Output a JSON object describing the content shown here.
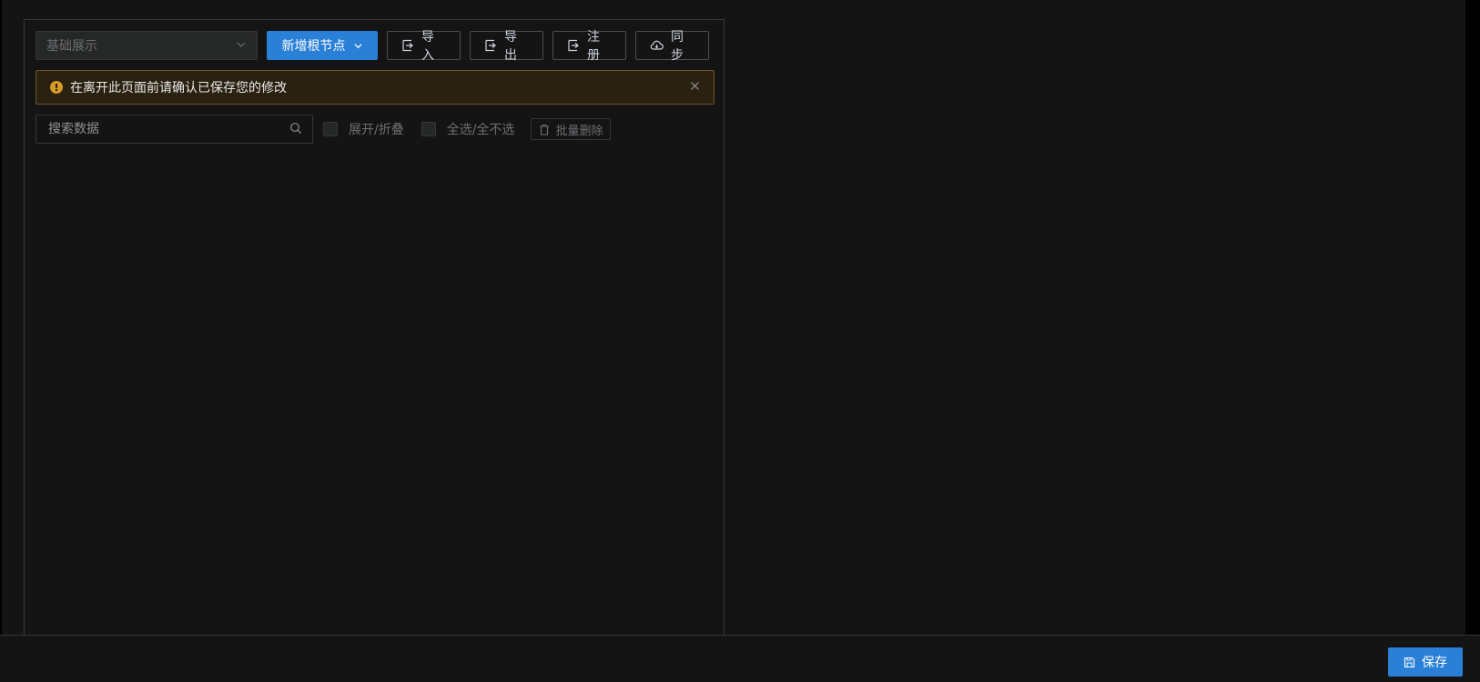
{
  "toolbar": {
    "select_placeholder": "基础展示",
    "add_root_label": "新增根节点",
    "import_label": "导入",
    "export_label": "导出",
    "register_label": "注册",
    "sync_label": "同步"
  },
  "notice": {
    "text": "在离开此页面前请确认已保存您的修改"
  },
  "search": {
    "placeholder": "搜索数据"
  },
  "options": {
    "expand_collapse_label": "展开/折叠",
    "select_all_label": "全选/全不选",
    "batch_delete_label": "批量删除"
  },
  "footer": {
    "save_label": "保存"
  },
  "colors": {
    "primary": "#2a7fd6",
    "warning": "#d89a26",
    "background": "#141414"
  }
}
